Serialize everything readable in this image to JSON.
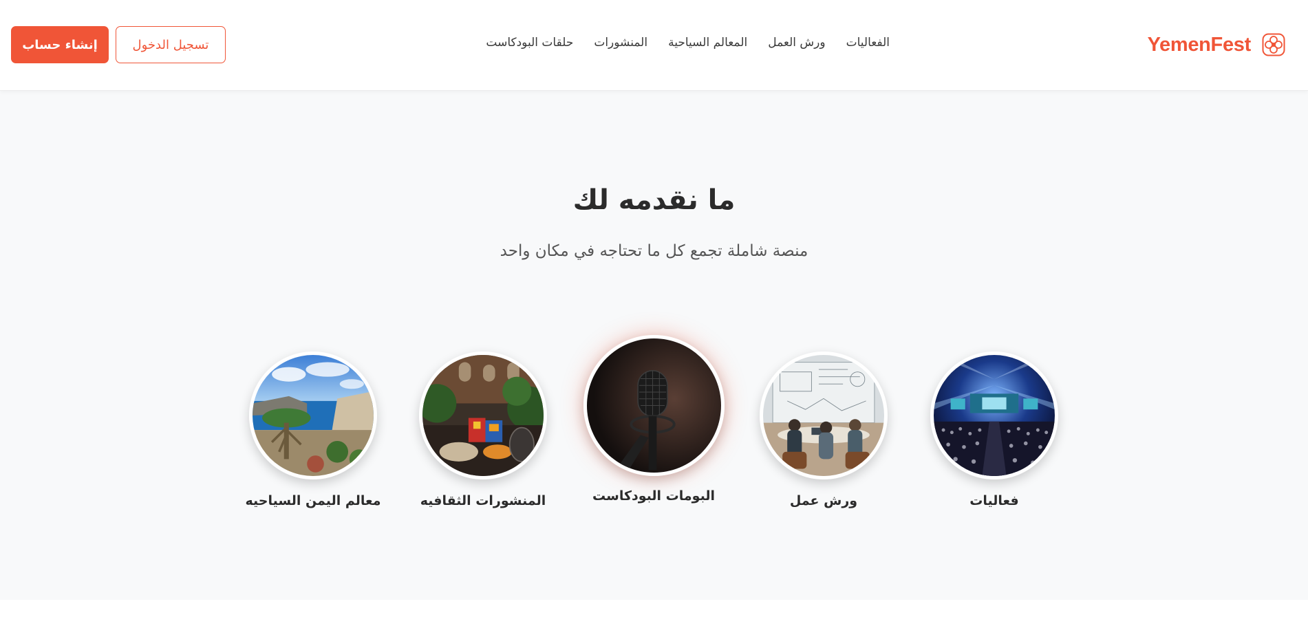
{
  "brand": {
    "name": "YemenFest",
    "icon": "flower-logo-icon",
    "accent": "#f05537"
  },
  "nav": {
    "items": [
      {
        "label": "الفعاليات"
      },
      {
        "label": "ورش العمل"
      },
      {
        "label": "المعالم السياحية"
      },
      {
        "label": "المنشورات"
      },
      {
        "label": "حلقات البودكاست"
      }
    ]
  },
  "auth": {
    "login_label": "تسجيل الدخول",
    "signup_label": "إنشاء حساب"
  },
  "section": {
    "title": "ما نقدمه لك",
    "subtitle": "منصة شاملة تجمع كل ما تحتاجه في مكان واحد"
  },
  "services": [
    {
      "label": "فعاليات",
      "image": "concert-crowd-image"
    },
    {
      "label": "ورش عمل",
      "image": "workshop-meeting-image"
    },
    {
      "label": "البومات البودكاست",
      "image": "microphone-image",
      "active": true
    },
    {
      "label": "المنشورات الثقافيه",
      "image": "cultural-food-image"
    },
    {
      "label": "معالم اليمن السياحيه",
      "image": "dragon-tree-coast-image"
    }
  ]
}
